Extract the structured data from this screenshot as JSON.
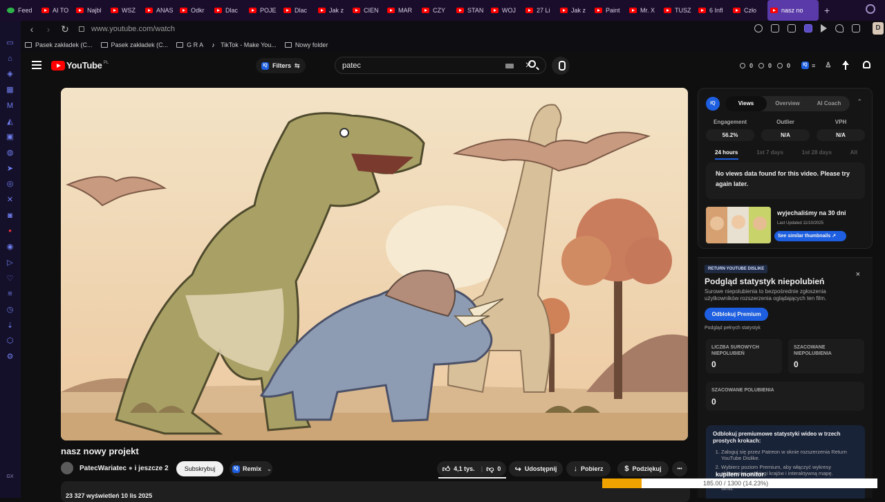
{
  "browser": {
    "tabs": [
      "Feed",
      "AI TO",
      "Najbl",
      "WSZ",
      "ANAS",
      "Odkr",
      "Dlac",
      "POJE",
      "Dlac",
      "Jak z",
      "CIEN",
      "MAR",
      "CZY",
      "STAN",
      "WOJ",
      "27 Li",
      "Jak z",
      "Paint",
      "Mr. X",
      "TUSZ",
      "6 Infl",
      "Czło"
    ],
    "active_tab": "nasz no",
    "new_tab": "+",
    "url": "www.youtube.com/watch",
    "profile_initial": "D",
    "bookmarks": [
      "Pasek zakładek (C...",
      "Pasek zakładek (C...",
      "G R A",
      "TikTok - Make You...",
      "Nowy folder"
    ]
  },
  "youtube": {
    "logo_text": "YouTube",
    "region": "PL",
    "filters_label": "Filters",
    "iq_label": "IQ",
    "search_value": "patec",
    "header_stats": [
      "0",
      "0",
      "0"
    ]
  },
  "video": {
    "title": "nasz nowy projekt",
    "channel": "PatecWariatec",
    "channel_extra": "i jeszcze 2",
    "subscribe_label": "Subskrybuj",
    "remix_label": "Remix",
    "likes": "4,1 tys.",
    "dislikes": "0",
    "share_label": "Udostępnij",
    "download_label": "Pobierz",
    "thanks_label": "Podziękuj",
    "more_label": "•••",
    "meta": "23 327 wyświetleń  10 lis 2025"
  },
  "iq_panel": {
    "badge": "IQ",
    "tabs": [
      "Views",
      "Overview",
      "AI Coach"
    ],
    "active_tab": "Views",
    "stats": [
      {
        "label": "Engagement",
        "value": "56.2%"
      },
      {
        "label": "Outlier",
        "value": "N/A"
      },
      {
        "label": "VPH",
        "value": "N/A"
      }
    ],
    "ranges": [
      "24 hours",
      "1st 7 days",
      "1st 28 days",
      "All"
    ],
    "active_range": "24 hours",
    "message": "No views data found for this video. Please try again later.",
    "similar_title": "wyjechaliśmy na 30 dni",
    "similar_updated": "Last Updated 11/10/2025",
    "similar_button": "See similar thumbnails ↗"
  },
  "ryd_panel": {
    "badge": "RETURN YOUTUBE DISLIKE",
    "close": "×",
    "title": "Podgląd statystyk niepolubień",
    "description": "Surowe niepolubienia to bezpośrednie zgłoszenia użytkowników rozszerzenia oglądających ten film.",
    "unlock_button": "Odblokuj Premium",
    "full_stats": "Podgląd pełnych statystyk",
    "cards": [
      {
        "label": "LICZBA SUROWYCH NIEPOLUBIEŃ",
        "value": "0"
      },
      {
        "label": "SZACOWANE NIEPOLUBIENIA",
        "value": "0"
      },
      {
        "label": "SZACOWANE POLUBIENIA",
        "value": "0"
      }
    ],
    "steps_title": "Odblokuj premiumowe statystyki wideo w trzech prostych krokach:",
    "steps": [
      "Zaloguj się przez Patreon w oknie rozszerzenia Return YouTube Dislike.",
      "Wybierz poziom Premium, aby włączyć wykresy aktywności, rankingi krajów i interaktywną mapę.",
      "Wyświetlaj szczegóły według stanów USA dla każdego filmu."
    ]
  },
  "download": {
    "name": "kupiłem monitor",
    "progress_text": "185.00 / 1300 (14.23%)",
    "progress_fraction": 0.1423,
    "fill_color": "#f0a200"
  },
  "sidebar_icons": [
    "inbox-icon",
    "home-icon",
    "bag-icon",
    "calendar-icon",
    "m-icon",
    "arrow-icon",
    "twitch-icon",
    "messenger-icon",
    "telegram-icon",
    "instagram-icon",
    "x-icon",
    "discord-icon",
    "ud-icon",
    "spotify-icon",
    "send-icon",
    "heart-icon",
    "layers-icon",
    "clock-icon",
    "download-icon",
    "puzzle-icon",
    "settings-icon"
  ],
  "sidebar_bottom": "GX"
}
